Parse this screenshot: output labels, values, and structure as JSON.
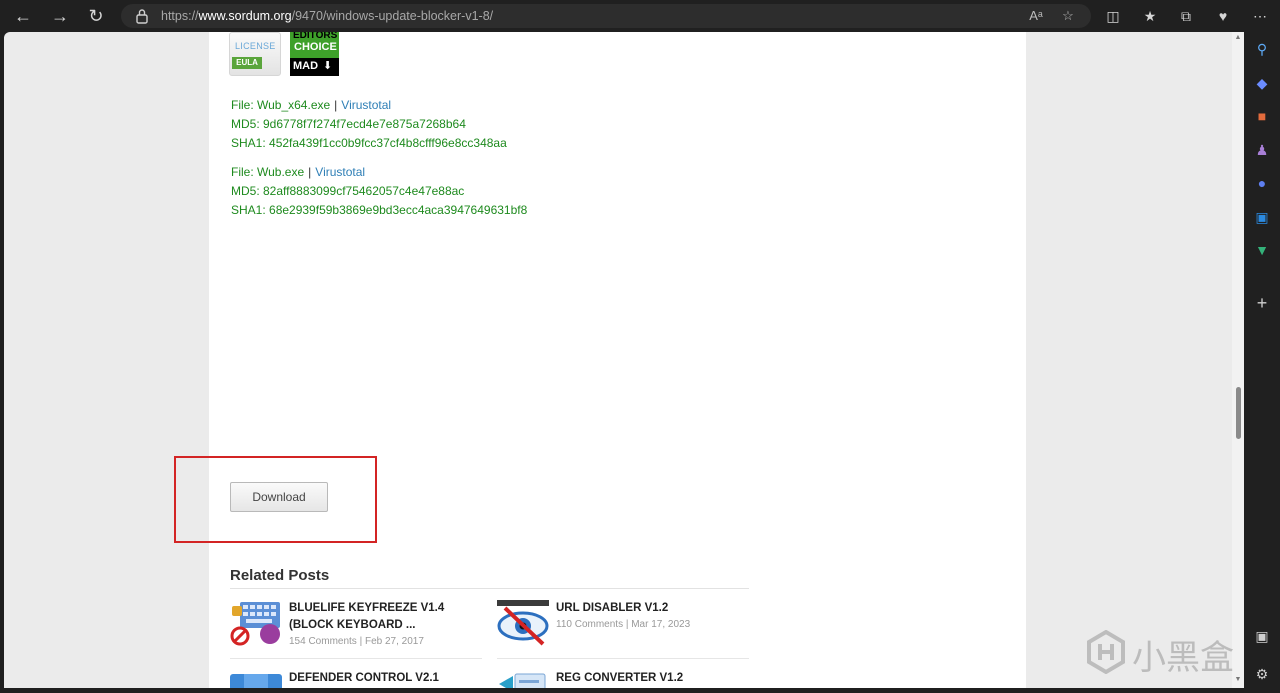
{
  "browser": {
    "url_prefix": "https://",
    "url_domain": "www.sordum.org",
    "url_path": "/9470/windows-update-blocker-v1-8/",
    "read_aloud_glyph": "Aᵃ"
  },
  "badges": {
    "license_text": "LICENSE",
    "eula_text": "EULA",
    "editors_text": "EDITORS",
    "choice_text": "CHOICE",
    "mad_text": "MAD"
  },
  "files": [
    {
      "file_label": "File: Wub_x64.exe",
      "separator": "|",
      "virustotal": "Virustotal",
      "md5": "MD5: 9d6778f7f274f7ecd4e7e875a7268b64",
      "sha1": "SHA1: 452fa439f1cc0b9fcc37cf4b8cfff96e8cc348aa"
    },
    {
      "file_label": "File: Wub.exe",
      "separator": "|",
      "virustotal": "Virustotal",
      "md5": "MD5: 82aff8883099cf75462057c4e47e88ac",
      "sha1": "SHA1: 68e2939f59b3869e9bd3ecc4aca3947649631bf8"
    }
  ],
  "download_button": "Download",
  "related": {
    "title": "Related Posts",
    "posts": [
      {
        "title": "BLUELIFE KEYFREEZE V1.4 (BLOCK KEYBOARD ...",
        "meta": "154 Comments | Feb 27, 2017"
      },
      {
        "title": "URL DISABLER V1.2",
        "meta": "110 Comments | Mar 17, 2023"
      },
      {
        "title": "DEFENDER CONTROL V2.1",
        "meta": ""
      },
      {
        "title": "REG CONVERTER V1.2",
        "meta": ""
      }
    ]
  },
  "watermark_text": "小黑盒",
  "colors": {
    "file_green": "#1e8a1e",
    "link_blue": "#2f7fb6",
    "highlight_red": "#d32424"
  }
}
